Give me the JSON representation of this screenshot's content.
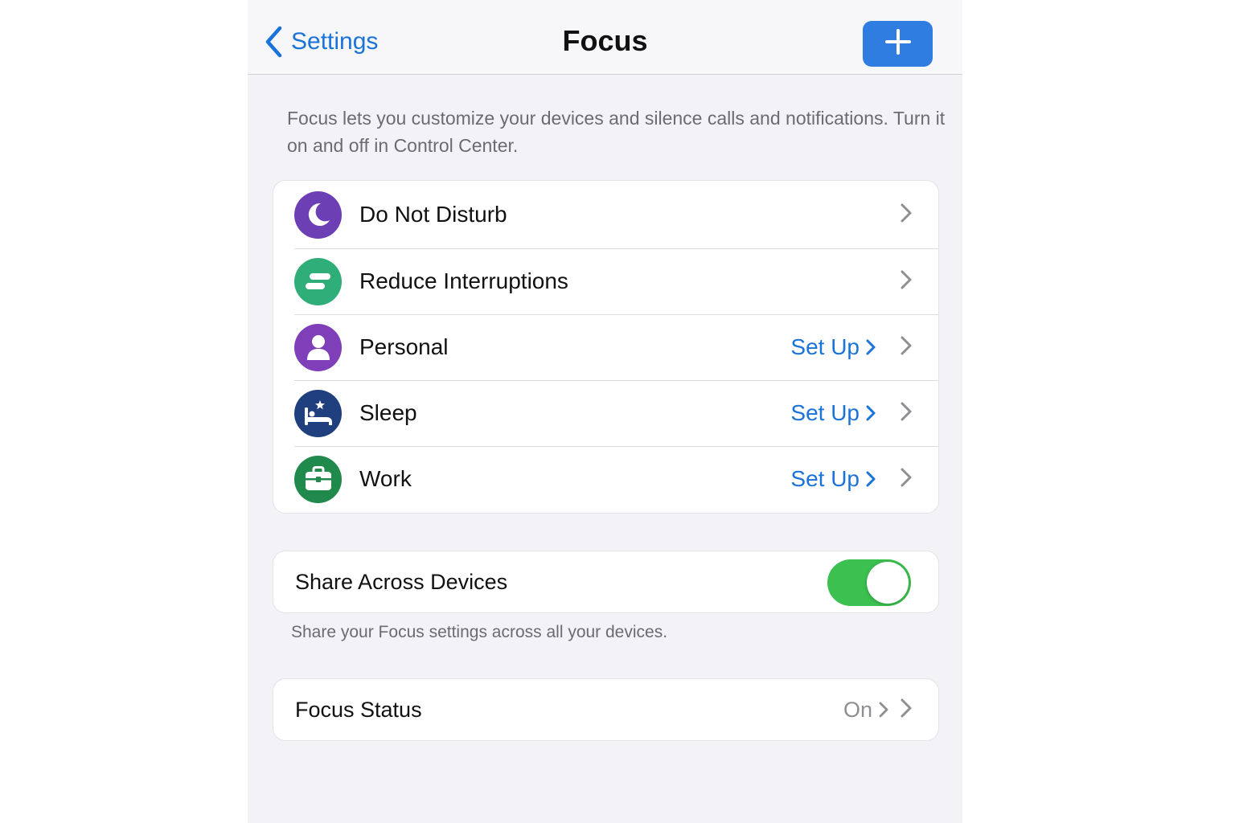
{
  "navbar": {
    "back_label": "Settings",
    "title": "Focus",
    "add_icon": "plus-icon"
  },
  "intro_text": "Focus lets you customize your devices and silence calls and notifications. Turn it on and off in Control Center.",
  "focus_modes": [
    {
      "label": "Do Not Disturb",
      "icon": "moon-icon",
      "icon_color": "#6d3fb5",
      "action": ""
    },
    {
      "label": "Reduce Interruptions",
      "icon": "reduce-interruptions-icon",
      "icon_color": "#2fae7a",
      "action": ""
    },
    {
      "label": "Personal",
      "icon": "person-icon",
      "icon_color": "#7f3fb8",
      "action": "Set Up"
    },
    {
      "label": "Sleep",
      "icon": "bed-icon",
      "icon_color": "#1f3f7e",
      "action": "Set Up"
    },
    {
      "label": "Work",
      "icon": "briefcase-icon",
      "icon_color": "#1f8a4c",
      "action": "Set Up"
    }
  ],
  "share": {
    "label": "Share Across Devices",
    "enabled": true,
    "caption": "Share your Focus settings across all your devices."
  },
  "focus_status": {
    "label": "Focus Status",
    "value": "On"
  },
  "colors": {
    "accent_blue": "#1a73d9",
    "toggle_on": "#3cc04f",
    "background": "#f2f2f7"
  }
}
